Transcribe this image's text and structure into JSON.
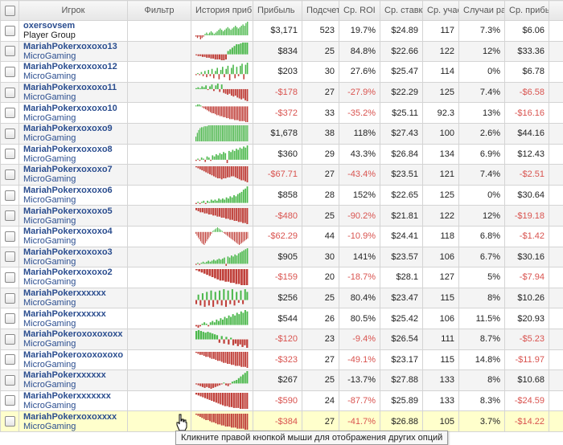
{
  "headers": {
    "player": "Игрок",
    "filter": "Фильтр",
    "history": "История прибь",
    "profit": "Прибыль",
    "count": "Подсчет",
    "roi": "Ср. ROI",
    "avg_stake": "Ср. ставк.",
    "avg_part": "Ср. учас",
    "cases": "Случаи ра",
    "avg_profit": "Ср. прибь"
  },
  "colors": {
    "positive": "#4cb84c",
    "negative": "#c0403a",
    "negative_text": "#d9534f"
  },
  "rows": [
    {
      "name": "oxersovsem",
      "site": "Player Group",
      "group": true,
      "profit": "$3,171",
      "count": "523",
      "roi": "19.7%",
      "stake": "$24.89",
      "part": "117",
      "cases": "7.3%",
      "avgp": "$6.06",
      "neg": false,
      "spark": [
        -1,
        -2,
        -1,
        -3,
        -2,
        -1,
        1,
        2,
        1,
        2,
        3,
        2,
        1,
        2,
        3,
        4,
        5,
        4,
        3,
        4,
        5,
        6,
        5,
        4,
        5,
        6,
        7,
        6,
        5,
        6,
        7,
        8,
        7,
        9,
        10
      ]
    },
    {
      "name": "MariahPokerxoxoxo13",
      "site": "MicroGaming",
      "profit": "$834",
      "count": "25",
      "roi": "84.8%",
      "stake": "$22.66",
      "part": "122",
      "cases": "12%",
      "avgp": "$33.36",
      "neg": false,
      "spark": [
        -1,
        -2,
        -2,
        -3,
        -3,
        -4,
        -4,
        -5,
        -5,
        -6,
        -6,
        -6,
        -7,
        -7,
        -6,
        4,
        6,
        8,
        10,
        12,
        12,
        13,
        14,
        14,
        14
      ]
    },
    {
      "name": "MariahPokerxoxoxo12",
      "site": "MicroGaming",
      "profit": "$203",
      "count": "30",
      "roi": "27.6%",
      "stake": "$25.47",
      "part": "114",
      "cases": "0%",
      "avgp": "$6.78",
      "neg": false,
      "spark": [
        -1,
        1,
        -1,
        2,
        -2,
        3,
        -3,
        4,
        -2,
        5,
        -4,
        3,
        6,
        -5,
        4,
        7,
        -3,
        5,
        8,
        -6,
        6,
        9,
        -4,
        7,
        -2,
        8,
        10,
        -5,
        9,
        11
      ]
    },
    {
      "name": "MariahPokerxoxoxo11",
      "site": "MicroGaming",
      "profit": "-$178",
      "count": "27",
      "roi": "-27.9%",
      "stake": "$22.29",
      "part": "125",
      "cases": "7.4%",
      "avgp": "-$6.58",
      "neg": true,
      "spark": [
        1,
        2,
        1,
        3,
        2,
        4,
        -1,
        3,
        5,
        -2,
        4,
        6,
        -3,
        5,
        -4,
        -5,
        -6,
        -5,
        -7,
        -8,
        -7,
        -9,
        -10,
        -11,
        -10,
        -12,
        -13
      ]
    },
    {
      "name": "MariahPokerxoxoxo10",
      "site": "MicroGaming",
      "profit": "-$372",
      "count": "33",
      "roi": "-35.2%",
      "stake": "$25.11",
      "part": "92.3",
      "cases": "13%",
      "avgp": "-$16.16",
      "neg": true,
      "spark": [
        1,
        2,
        2,
        1,
        -1,
        -2,
        -3,
        -4,
        -5,
        -6,
        -7,
        -7,
        -8,
        -9,
        -9,
        -10,
        -10,
        -11,
        -11,
        -12,
        -12,
        -13,
        -13,
        -13,
        -14,
        -14,
        -14,
        -15,
        -15,
        -15,
        -15,
        -16,
        -16
      ]
    },
    {
      "name": "MariahPokerxoxoxo9",
      "site": "MicroGaming",
      "profit": "$1,678",
      "count": "38",
      "roi": "118%",
      "stake": "$27.43",
      "part": "100",
      "cases": "2.6%",
      "avgp": "$44.16",
      "neg": false,
      "spark": [
        5,
        9,
        12,
        14,
        15,
        15,
        16,
        16,
        16,
        17,
        17,
        17,
        17,
        17,
        17,
        17,
        17,
        17,
        17,
        17,
        17,
        17,
        17,
        17,
        17,
        17,
        17,
        17,
        17,
        17,
        17,
        17,
        17,
        17,
        17,
        17,
        17,
        17
      ]
    },
    {
      "name": "MariahPokerxoxoxo8",
      "site": "MicroGaming",
      "profit": "$360",
      "count": "29",
      "roi": "43.3%",
      "stake": "$26.84",
      "part": "134",
      "cases": "6.9%",
      "avgp": "$12.43",
      "neg": false,
      "spark": [
        -1,
        1,
        -1,
        2,
        1,
        -2,
        3,
        2,
        -1,
        4,
        3,
        5,
        4,
        6,
        5,
        7,
        6,
        -3,
        8,
        7,
        9,
        8,
        10,
        9,
        11,
        10,
        12,
        11,
        13
      ]
    },
    {
      "name": "MariahPokerxoxoxo7",
      "site": "MicroGaming",
      "profit": "-$67.71",
      "count": "27",
      "roi": "-43.4%",
      "stake": "$23.51",
      "part": "121",
      "cases": "7.4%",
      "avgp": "-$2.51",
      "neg": true,
      "spark": [
        -1,
        -2,
        -3,
        -4,
        -5,
        -6,
        -7,
        -8,
        -9,
        -10,
        -11,
        -12,
        -12,
        -13,
        -12,
        -12,
        -11,
        -11,
        -10,
        -10,
        -11,
        -12,
        -13,
        -14,
        -14,
        -15,
        -16
      ]
    },
    {
      "name": "MariahPokerxoxoxo6",
      "site": "MicroGaming",
      "profit": "$858",
      "count": "28",
      "roi": "152%",
      "stake": "$22.65",
      "part": "125",
      "cases": "0%",
      "avgp": "$30.64",
      "neg": false,
      "spark": [
        -1,
        1,
        -1,
        1,
        2,
        -1,
        2,
        1,
        3,
        2,
        3,
        2,
        4,
        3,
        4,
        3,
        5,
        4,
        6,
        5,
        7,
        6,
        8,
        9,
        10,
        12,
        13,
        15
      ]
    },
    {
      "name": "MariahPokerxoxoxo5",
      "site": "MicroGaming",
      "profit": "-$480",
      "count": "25",
      "roi": "-90.2%",
      "stake": "$21.81",
      "part": "122",
      "cases": "12%",
      "avgp": "-$19.18",
      "neg": true,
      "spark": [
        -2,
        -3,
        -4,
        -4,
        -5,
        -5,
        -6,
        -6,
        -7,
        -7,
        -8,
        -8,
        -9,
        -9,
        -10,
        -10,
        -11,
        -11,
        -12,
        -12,
        -13,
        -13,
        -14,
        -14,
        -15
      ]
    },
    {
      "name": "MariahPokerxoxoxo4",
      "site": "MicroGaming",
      "profit": "-$62.29",
      "count": "44",
      "roi": "-10.9%",
      "stake": "$24.41",
      "part": "118",
      "cases": "6.8%",
      "avgp": "-$1.42",
      "neg": true,
      "spark": [
        -2,
        -4,
        -6,
        -8,
        -10,
        -12,
        -13,
        -14,
        -12,
        -10,
        -8,
        -6,
        -4,
        -2,
        1,
        2,
        3,
        4,
        5,
        4,
        3,
        2,
        1,
        -1,
        -2,
        -3,
        -4,
        -5,
        -6,
        -7,
        -8,
        -9,
        -10,
        -11,
        -12,
        -13,
        -14,
        -13,
        -12,
        -11,
        -10,
        -9,
        -8,
        -7
      ]
    },
    {
      "name": "MariahPokerxoxoxo3",
      "site": "MicroGaming",
      "profit": "$905",
      "count": "30",
      "roi": "141%",
      "stake": "$23.57",
      "part": "106",
      "cases": "6.7%",
      "avgp": "$30.16",
      "neg": false,
      "spark": [
        -1,
        1,
        -1,
        1,
        2,
        1,
        2,
        3,
        2,
        3,
        4,
        3,
        4,
        5,
        4,
        5,
        6,
        -2,
        7,
        6,
        8,
        7,
        9,
        8,
        10,
        11,
        12,
        13,
        14,
        15
      ]
    },
    {
      "name": "MariahPokerxoxoxo2",
      "site": "MicroGaming",
      "profit": "-$159",
      "count": "20",
      "roi": "-18.7%",
      "stake": "$28.1",
      "part": "127",
      "cases": "5%",
      "avgp": "-$7.94",
      "neg": true,
      "spark": [
        -1,
        -2,
        -3,
        -4,
        -5,
        -6,
        -7,
        -8,
        -9,
        -10,
        -10,
        -11,
        -11,
        -12,
        -12,
        -13,
        -13,
        -14,
        -14,
        -14
      ]
    },
    {
      "name": "MariahPokerxxxxxx",
      "site": "MicroGaming",
      "profit": "$256",
      "count": "25",
      "roi": "80.4%",
      "stake": "$23.47",
      "part": "115",
      "cases": "8%",
      "avgp": "$10.26",
      "neg": false,
      "spark": [
        -3,
        4,
        -4,
        5,
        -5,
        6,
        -4,
        7,
        -5,
        6,
        -3,
        7,
        -4,
        8,
        -5,
        7,
        -3,
        8,
        -4,
        6,
        -2,
        7,
        -3,
        8,
        6
      ]
    },
    {
      "name": "MariahPokerxxxxxx",
      "site": "MicroGaming",
      "profit": "$544",
      "count": "26",
      "roi": "80.5%",
      "stake": "$25.42",
      "part": "106",
      "cases": "11.5%",
      "avgp": "$20.93",
      "neg": false,
      "spark": [
        -1,
        -2,
        -1,
        1,
        2,
        1,
        -1,
        2,
        3,
        2,
        4,
        3,
        5,
        4,
        6,
        5,
        7,
        6,
        8,
        7,
        9,
        8,
        10,
        9,
        11,
        10
      ]
    },
    {
      "name": "MariahPokeroxoxoxoxx",
      "site": "MicroGaming",
      "profit": "-$120",
      "count": "23",
      "roi": "-9.4%",
      "stake": "$26.54",
      "part": "111",
      "cases": "8.7%",
      "avgp": "-$5.23",
      "neg": true,
      "spark": [
        10,
        11,
        10,
        9,
        8,
        9,
        8,
        7,
        6,
        5,
        -4,
        4,
        -5,
        3,
        -6,
        2,
        -7,
        -5,
        -8,
        -6,
        -9,
        -7,
        -10
      ]
    },
    {
      "name": "MariahPokeroxoxoxoxo",
      "site": "MicroGaming",
      "profit": "-$323",
      "count": "27",
      "roi": "-49.1%",
      "stake": "$23.17",
      "part": "115",
      "cases": "14.8%",
      "avgp": "-$11.97",
      "neg": true,
      "spark": [
        -1,
        -2,
        -3,
        -3,
        -4,
        -5,
        -5,
        -6,
        -7,
        -7,
        -8,
        -9,
        -9,
        -10,
        -11,
        -11,
        -12,
        -12,
        -13,
        -13,
        -14,
        -14,
        -14,
        -15,
        -15,
        -15,
        -16
      ]
    },
    {
      "name": "MariahPokerxxxxxx",
      "site": "MicroGaming",
      "profit": "$267",
      "count": "25",
      "roi": "-13.7%",
      "stake": "$27.88",
      "part": "133",
      "cases": "8%",
      "avgp": "$10.68",
      "neg": false,
      "spark": [
        -1,
        -2,
        -3,
        -4,
        -5,
        -4,
        -5,
        -6,
        -5,
        -4,
        -3,
        -2,
        -1,
        1,
        -2,
        -3,
        -1,
        2,
        3,
        4,
        6,
        8,
        10,
        12,
        14
      ]
    },
    {
      "name": "MariahPokerxxxxxxx",
      "site": "MicroGaming",
      "profit": "-$590",
      "count": "24",
      "roi": "-87.7%",
      "stake": "$25.89",
      "part": "133",
      "cases": "8.3%",
      "avgp": "-$24.59",
      "neg": true,
      "spark": [
        -2,
        -3,
        -4,
        -5,
        -6,
        -7,
        -8,
        -9,
        -10,
        -11,
        -12,
        -13,
        -14,
        -15,
        -15,
        -16,
        -16,
        -17,
        -17,
        -17,
        -18,
        -18,
        -18,
        -18
      ]
    },
    {
      "name": "MariahPokerxoxoxxxx",
      "site": "MicroGaming",
      "profit": "-$384",
      "count": "27",
      "roi": "-41.7%",
      "stake": "$26.88",
      "part": "105",
      "cases": "3.7%",
      "avgp": "-$14.22",
      "neg": true,
      "selected": true,
      "spark": [
        -1,
        -2,
        -3,
        -4,
        -5,
        -6,
        -6,
        -7,
        -8,
        -8,
        -9,
        -10,
        -10,
        -11,
        -11,
        -12,
        -12,
        -12,
        -13,
        -13,
        -13,
        -14,
        -14,
        -14,
        -14,
        -15,
        -15
      ]
    }
  ],
  "tooltip": "Кликните правой кнопкой мыши для отображения других опций"
}
